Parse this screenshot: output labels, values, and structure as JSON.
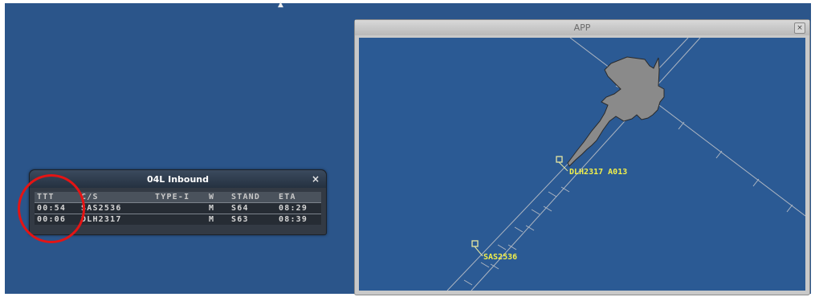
{
  "inbound_window": {
    "title": "04L Inbound",
    "close_glyph": "×",
    "headers": {
      "ttt": "TTT",
      "cs": "C/S",
      "type": "TYPE-I",
      "w": "W",
      "stand": "STAND",
      "eta": "ETA"
    },
    "rows": [
      {
        "ttt": "00:54",
        "cs": "SAS2536",
        "type": "",
        "w": "M",
        "stand": "S64",
        "eta": "08:29"
      },
      {
        "ttt": "00:06",
        "cs": "DLH2317",
        "type": "",
        "w": "M",
        "stand": "S63",
        "eta": "08:39"
      }
    ]
  },
  "app_window": {
    "title": "APP",
    "close_glyph": "×",
    "aircraft": [
      {
        "label": "DLH2317 A013",
        "icon": "aircraft-target-icon"
      },
      {
        "label": "SAS2536",
        "icon": "aircraft-target-icon"
      }
    ]
  },
  "colors": {
    "desktop": "#2b558a",
    "radar_bg": "#2b5a94",
    "label_yellow": "#f2f04a",
    "annotation_red": "#e41414",
    "airport_gray": "#8a8a8a"
  }
}
